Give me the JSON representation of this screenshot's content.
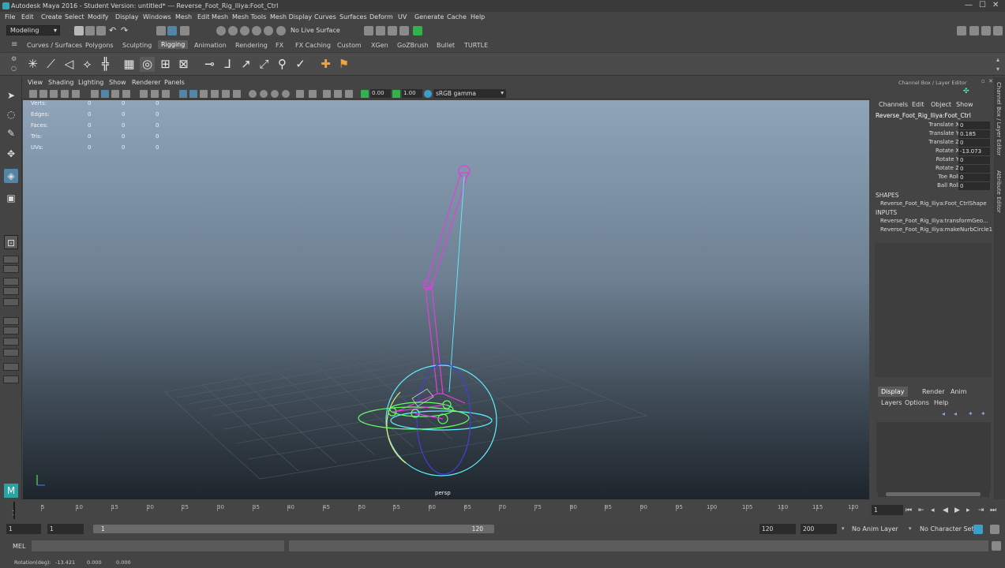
{
  "window": {
    "title": "Autodesk Maya 2016 - Student Version: untitled*   ---   Reverse_Foot_Rig_Iliya:Foot_Ctrl"
  },
  "menubar": [
    "File",
    "Edit",
    "Create",
    "Select",
    "Modify",
    "Display",
    "Windows",
    "Mesh",
    "Edit Mesh",
    "Mesh Tools",
    "Mesh Display",
    "Curves",
    "Surfaces",
    "Deform",
    "UV",
    "Generate",
    "Cache",
    "Help"
  ],
  "statusline": {
    "mode": "Modeling",
    "live_surface": "No Live Surface"
  },
  "shelf_tabs": [
    "Curves / Surfaces",
    "Polygons",
    "Sculpting",
    "Rigging",
    "Animation",
    "Rendering",
    "FX",
    "FX Caching",
    "Custom",
    "XGen",
    "GoZBrush",
    "Bullet",
    "TURTLE"
  ],
  "shelf_active": "Rigging",
  "panel_menu": [
    "View",
    "Shading",
    "Lighting",
    "Show",
    "Renderer",
    "Panels"
  ],
  "panel_toolbar": {
    "exposure": "0.00",
    "gamma_value": "1.00",
    "color_space": "sRGB gamma"
  },
  "hud": {
    "rows": [
      {
        "label": "Verts:",
        "values": [
          "0",
          "0",
          "0"
        ]
      },
      {
        "label": "Edges:",
        "values": [
          "0",
          "0",
          "0"
        ]
      },
      {
        "label": "Faces:",
        "values": [
          "0",
          "0",
          "0"
        ]
      },
      {
        "label": "Tris:",
        "values": [
          "0",
          "0",
          "0"
        ]
      },
      {
        "label": "UVs:",
        "values": [
          "0",
          "0",
          "0"
        ]
      }
    ],
    "camera": "persp"
  },
  "timeline": {
    "ticks": [
      "5",
      "10",
      "15",
      "20",
      "25",
      "30",
      "35",
      "40",
      "45",
      "50",
      "55",
      "60",
      "65",
      "70",
      "75",
      "80",
      "85",
      "90",
      "95",
      "100",
      "105",
      "110",
      "115",
      "120"
    ],
    "start_label": "1",
    "current_frame": "1"
  },
  "range": {
    "start": "1",
    "inner_start": "1",
    "range_start_label": "1",
    "range_end_label": "120",
    "end": "120",
    "max": "200",
    "anim_layer": "No Anim Layer",
    "character_set": "No Character Set"
  },
  "cmdline": {
    "language": "MEL"
  },
  "helpline": {
    "label": "Rotation(deg):",
    "values": [
      "-13.421",
      "0.000",
      "0.000"
    ]
  },
  "channelbox": {
    "header": "Channel Box / Layer Editor",
    "menu": [
      "Channels",
      "Edit",
      "Object",
      "Show"
    ],
    "object_name": "Reverse_Foot_Rig_Iliya:Foot_Ctrl",
    "attributes": [
      {
        "label": "Translate X",
        "value": "0"
      },
      {
        "label": "Translate Y",
        "value": "0.185"
      },
      {
        "label": "Translate Z",
        "value": "0"
      },
      {
        "label": "Rotate X",
        "value": "-13.073"
      },
      {
        "label": "Rotate Y",
        "value": "0"
      },
      {
        "label": "Rotate Z",
        "value": "0"
      },
      {
        "label": "Toe Roll",
        "value": "0"
      },
      {
        "label": "Ball Roll",
        "value": "0"
      }
    ],
    "shapes_label": "SHAPES",
    "shapes": [
      "Reverse_Foot_Rig_Iliya:Foot_CtrlShape"
    ],
    "inputs_label": "INPUTS",
    "inputs": [
      "Reverse_Foot_Rig_Iliya:transformGeo...",
      "Reverse_Foot_Rig_Iliya:makeNurbCircle1"
    ]
  },
  "layer_editor": {
    "tabs": [
      "Display",
      "Render",
      "Anim"
    ],
    "active_tab": "Display",
    "menu": [
      "Layers",
      "Options",
      "Help"
    ]
  },
  "side_tabs": [
    "Channel Box / Layer Editor",
    "Attribute Editor"
  ],
  "colors": {
    "accent_select": "#5285a6",
    "rig_joint": "#e040e0",
    "rig_control": "#5ef0ff",
    "rig_green": "#62ff62",
    "rig_yellow": "#e8e86a"
  }
}
